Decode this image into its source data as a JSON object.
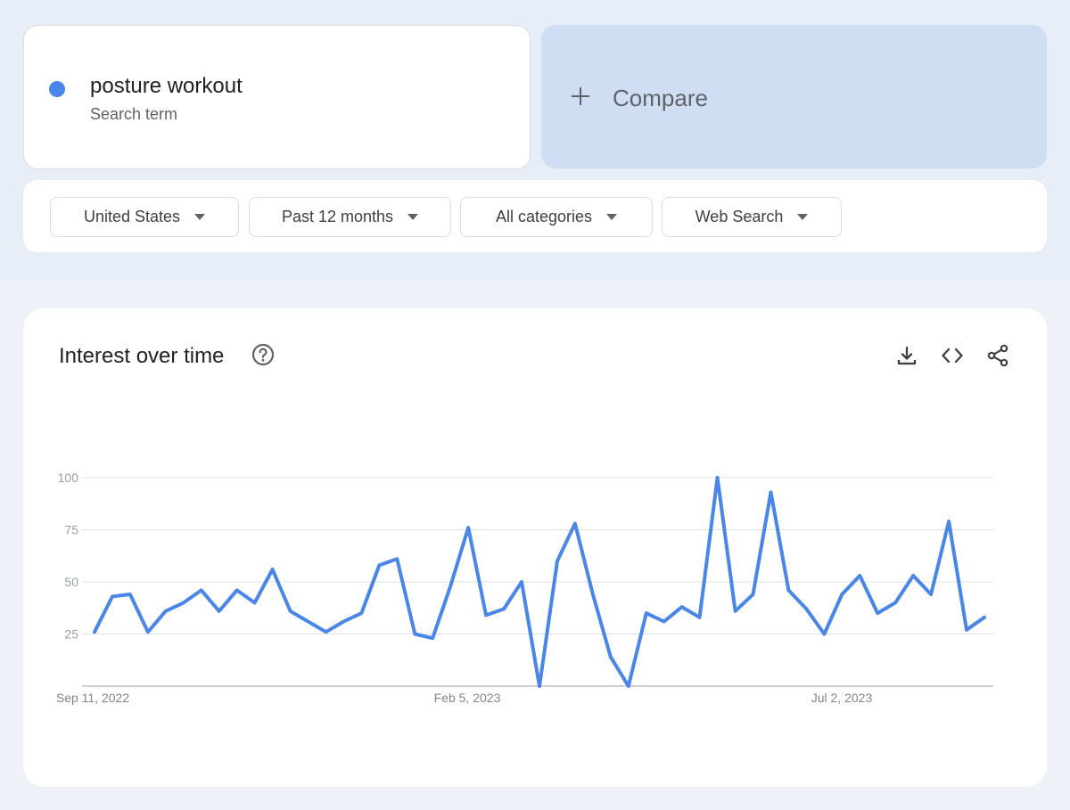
{
  "search_term": {
    "name": "posture workout",
    "subtitle": "Search term",
    "dot_color": "#4a86e8"
  },
  "compare": {
    "label": "Compare",
    "icon": "plus-icon"
  },
  "filters": [
    {
      "label": "United States"
    },
    {
      "label": "Past 12 months"
    },
    {
      "label": "All categories"
    },
    {
      "label": "Web Search"
    }
  ],
  "chart_panel": {
    "title": "Interest over time",
    "icons": [
      "help-icon",
      "download-icon",
      "embed-icon",
      "share-icon"
    ]
  },
  "chart_data": {
    "type": "line",
    "title": "Interest over time",
    "xlabel": "",
    "ylabel": "",
    "ylim": [
      0,
      100
    ],
    "y_ticks": [
      25,
      50,
      75,
      100
    ],
    "x_tick_labels": [
      "Sep 11, 2022",
      "Feb 5, 2023",
      "Jul 2, 2023"
    ],
    "grid": true,
    "line_color": "#4a86e8",
    "series": [
      {
        "values": [
          26,
          43,
          44,
          26,
          36,
          40,
          46,
          36,
          46,
          40,
          56,
          36,
          31,
          26,
          31,
          35,
          58,
          61,
          25,
          23,
          48,
          76,
          34,
          37,
          50,
          0,
          60,
          78,
          44,
          14,
          0,
          35,
          31,
          38,
          33,
          100,
          36,
          44,
          93,
          46,
          37,
          25,
          44,
          53,
          35,
          40,
          53,
          44,
          79,
          27,
          33
        ]
      }
    ]
  }
}
